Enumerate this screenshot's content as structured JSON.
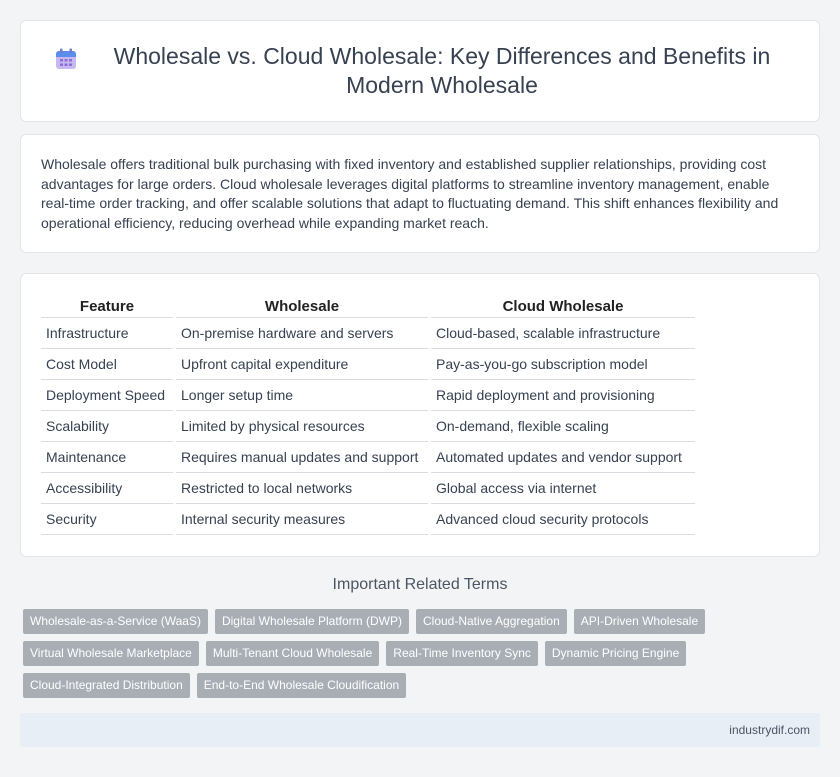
{
  "header": {
    "title": "Wholesale vs. Cloud Wholesale: Key Differences and Benefits in Modern Wholesale",
    "icon": "calendar-icon"
  },
  "intro": {
    "text": "Wholesale offers traditional bulk purchasing with fixed inventory and established supplier relationships, providing cost advantages for large orders. Cloud wholesale leverages digital platforms to streamline inventory management, enable real-time order tracking, and offer scalable solutions that adapt to fluctuating demand. This shift enhances flexibility and operational efficiency, reducing overhead while expanding market reach."
  },
  "table": {
    "headers": [
      "Feature",
      "Wholesale",
      "Cloud Wholesale"
    ],
    "rows": [
      [
        "Infrastructure",
        "On-premise hardware and servers",
        "Cloud-based, scalable infrastructure"
      ],
      [
        "Cost Model",
        "Upfront capital expenditure",
        "Pay-as-you-go subscription model"
      ],
      [
        "Deployment Speed",
        "Longer setup time",
        "Rapid deployment and provisioning"
      ],
      [
        "Scalability",
        "Limited by physical resources",
        "On-demand, flexible scaling"
      ],
      [
        "Maintenance",
        "Requires manual updates and support",
        "Automated updates and vendor support"
      ],
      [
        "Accessibility",
        "Restricted to local networks",
        "Global access via internet"
      ],
      [
        "Security",
        "Internal security measures",
        "Advanced cloud security protocols"
      ]
    ]
  },
  "related": {
    "title": "Important Related Terms",
    "tags": [
      "Wholesale-as-a-Service (WaaS)",
      "Digital Wholesale Platform (DWP)",
      "Cloud-Native Aggregation",
      "API-Driven Wholesale",
      "Virtual Wholesale Marketplace",
      "Multi-Tenant Cloud Wholesale",
      "Real-Time Inventory Sync",
      "Dynamic Pricing Engine",
      "Cloud-Integrated Distribution",
      "End-to-End Wholesale Cloudification"
    ]
  },
  "footer": {
    "site": "industrydif.com"
  }
}
